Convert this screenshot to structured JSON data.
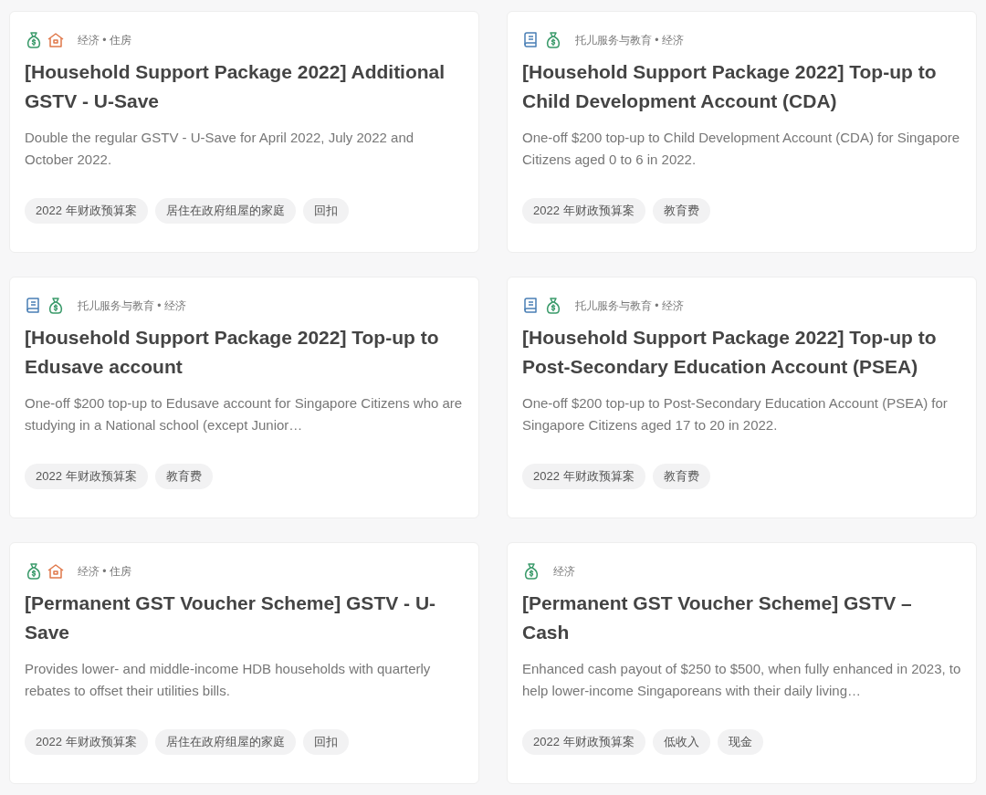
{
  "cards": [
    {
      "icons": [
        {
          "kind": "money"
        },
        {
          "kind": "house"
        }
      ],
      "categories": "经济 • 住房",
      "title": "[Household Support Package 2022] Additional GSTV - U-Save",
      "description": "Double the regular GSTV - U-Save for April 2022, July 2022 and October 2022.",
      "tags": [
        "2022 年财政预算案",
        "居住在政府组屋的家庭",
        "回扣"
      ]
    },
    {
      "icons": [
        {
          "kind": "education"
        },
        {
          "kind": "money"
        }
      ],
      "categories": "托儿服务与教育 • 经济",
      "title": "[Household Support Package 2022] Top-up to Child Development Account (CDA)",
      "description": "One-off $200 top-up to Child Development Account (CDA) for Singapore Citizens aged 0 to 6 in 2022.",
      "tags": [
        "2022 年财政预算案",
        "教育费"
      ]
    },
    {
      "icons": [
        {
          "kind": "education"
        },
        {
          "kind": "money"
        }
      ],
      "categories": "托儿服务与教育 • 经济",
      "title": "[Household Support Package 2022] Top-up to Edusave account",
      "description": "One-off $200 top-up to Edusave account for Singapore Citizens who are studying in a National school (except Junior…",
      "tags": [
        "2022 年财政预算案",
        "教育费"
      ]
    },
    {
      "icons": [
        {
          "kind": "education"
        },
        {
          "kind": "money"
        }
      ],
      "categories": "托儿服务与教育 • 经济",
      "title": "[Household Support Package 2022] Top-up to Post-Secondary Education Account (PSEA)",
      "description": "One-off $200 top-up to Post-Secondary Education Account (PSEA) for Singapore Citizens aged 17 to 20 in 2022.",
      "tags": [
        "2022 年财政预算案",
        "教育费"
      ]
    },
    {
      "icons": [
        {
          "kind": "money"
        },
        {
          "kind": "house"
        }
      ],
      "categories": "经济 • 住房",
      "title": "[Permanent GST Voucher Scheme] GSTV - U-Save",
      "description": "Provides lower- and middle-income HDB households with quarterly rebates to offset their utilities bills.",
      "tags": [
        "2022 年财政预算案",
        "居住在政府组屋的家庭",
        "回扣"
      ]
    },
    {
      "icons": [
        {
          "kind": "money"
        }
      ],
      "categories": "经济",
      "title": "[Permanent GST Voucher Scheme] GSTV – Cash",
      "description": "Enhanced cash payout of $250 to $500, when fully enhanced in 2023, to help lower-income Singaporeans with their daily living…",
      "tags": [
        "2022 年财政预算案",
        "低收入",
        "现金"
      ]
    }
  ]
}
